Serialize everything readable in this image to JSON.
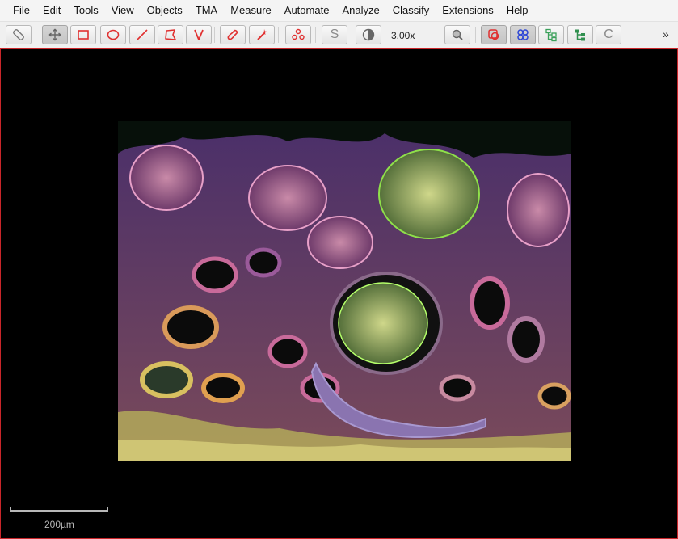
{
  "menu": {
    "items": [
      "File",
      "Edit",
      "Tools",
      "View",
      "Objects",
      "TMA",
      "Measure",
      "Automate",
      "Analyze",
      "Classify",
      "Extensions",
      "Help"
    ]
  },
  "toolbar": {
    "zoom_label": "3.00x",
    "brightness_letter": "S",
    "channel_letter": "C",
    "more_glyph": "»",
    "accent_color": "#e03030"
  },
  "viewer": {
    "scale_label": "200µm",
    "border_color": "#c9262a"
  }
}
